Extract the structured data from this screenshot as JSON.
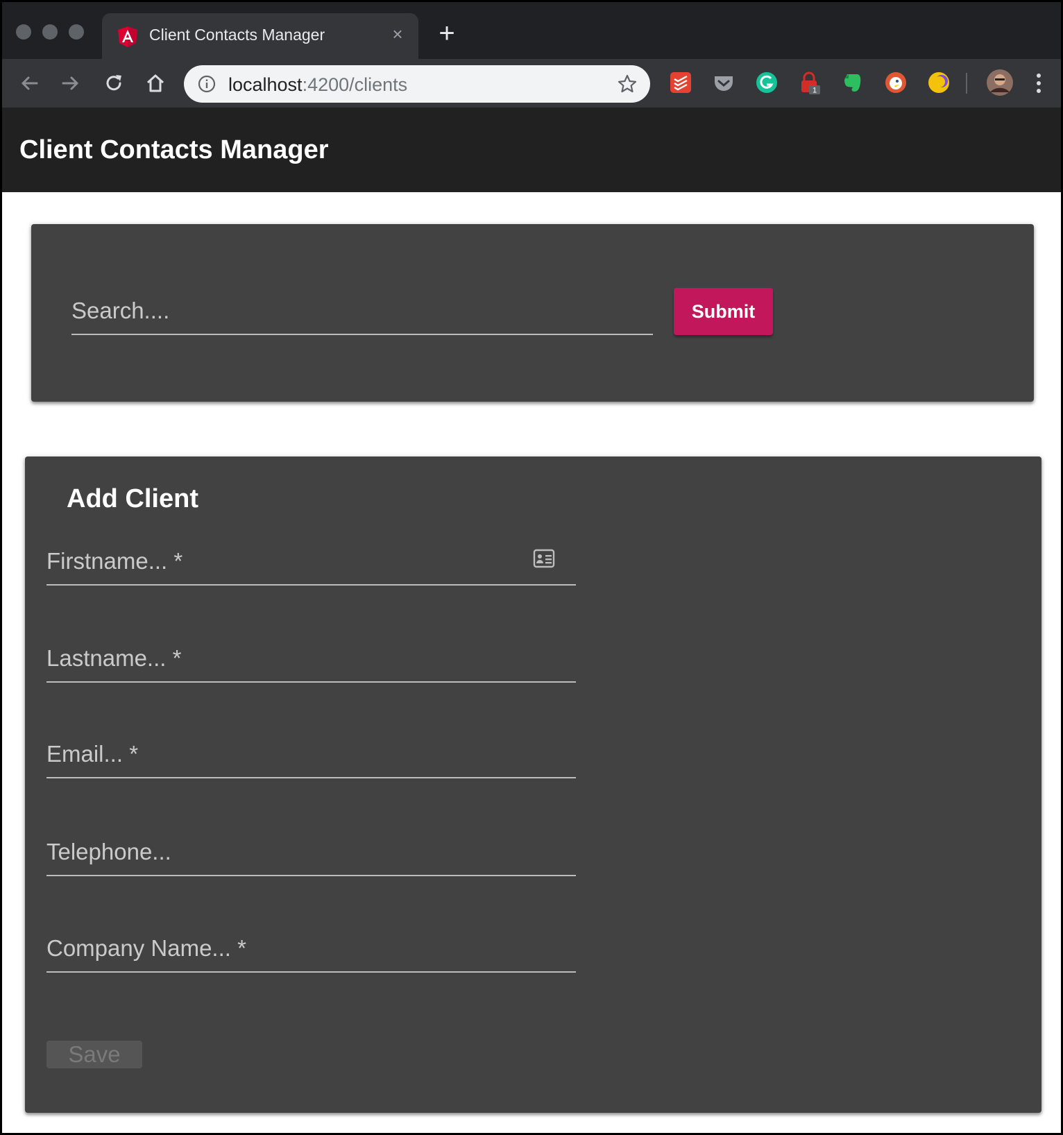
{
  "browser": {
    "tab_title": "Client Contacts Manager",
    "new_tab_symbol": "+",
    "close_symbol": "×",
    "url_host": "localhost",
    "url_path": ":4200/clients",
    "extension_badge": "1",
    "extensions": [
      "todoist-icon",
      "pocket-icon",
      "grammarly-icon",
      "lastpass-icon",
      "evernote-icon",
      "duckduckgo-icon",
      "moon-icon"
    ]
  },
  "app": {
    "title": "Client Contacts Manager"
  },
  "search": {
    "placeholder": "Search....",
    "submit_label": "Submit"
  },
  "add_client": {
    "title": "Add Client",
    "fields": {
      "firstname": "Firstname... *",
      "lastname": "Lastname... *",
      "email": "Email... *",
      "telephone": "Telephone...",
      "company": "Company Name... *"
    },
    "save_label": "Save"
  },
  "colors": {
    "appbar": "#212121",
    "card": "#424242",
    "accent": "#c2185b"
  }
}
